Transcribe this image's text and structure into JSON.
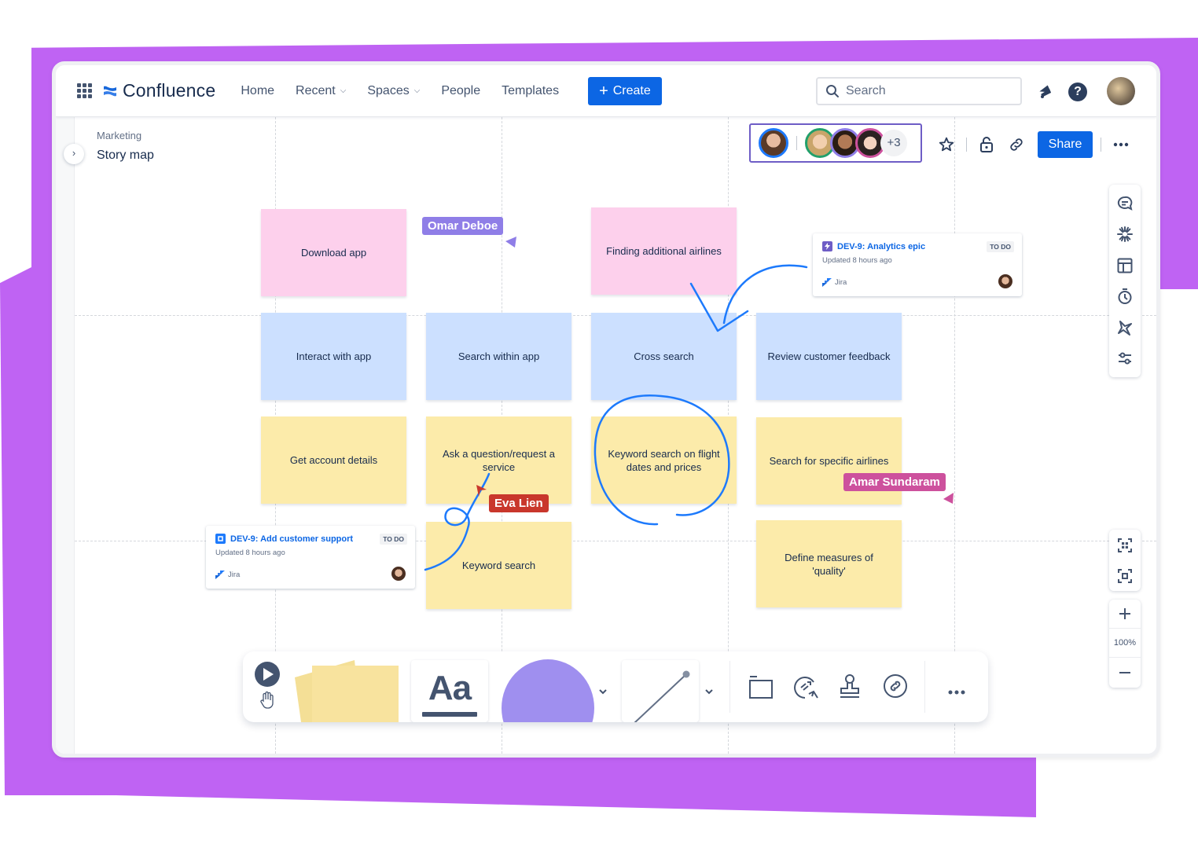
{
  "app": {
    "name": "Confluence"
  },
  "topnav": {
    "items": [
      {
        "label": "Home",
        "has_dropdown": false
      },
      {
        "label": "Recent",
        "has_dropdown": true
      },
      {
        "label": "Spaces",
        "has_dropdown": true
      },
      {
        "label": "People",
        "has_dropdown": false
      },
      {
        "label": "Templates",
        "has_dropdown": false
      }
    ],
    "create_label": "Create",
    "search_placeholder": "Search",
    "icons": [
      "app-switcher-icon",
      "notifications-icon",
      "help-icon",
      "profile-avatar"
    ]
  },
  "page": {
    "breadcrumb": "Marketing",
    "title": "Story map",
    "collaborators": {
      "current": {
        "ring_color": "#1d7afc"
      },
      "others": [
        {
          "ring_color": "#22a06b"
        },
        {
          "ring_color": "#8f7ee7"
        },
        {
          "ring_color": "#cd519d"
        }
      ],
      "more_count": "+3"
    },
    "actions": {
      "share_label": "Share"
    }
  },
  "right_toolbar": {
    "tools": [
      "comment-icon",
      "ai-sparkle-icon",
      "template-icon",
      "timer-icon",
      "vote-icon",
      "settings-sliders-icon"
    ],
    "zoom_level": "100%"
  },
  "stickies": [
    {
      "text": "Download app",
      "color": "pink"
    },
    {
      "text": "Finding additional airlines",
      "color": "pink"
    },
    {
      "text": "Interact with app",
      "color": "blue"
    },
    {
      "text": "Search within app",
      "color": "blue"
    },
    {
      "text": "Cross search",
      "color": "blue"
    },
    {
      "text": "Review customer feedback",
      "color": "blue"
    },
    {
      "text": "Get account details",
      "color": "yellow"
    },
    {
      "text": "Ask a question/request a service",
      "color": "yellow"
    },
    {
      "text": "Keyword search on flight dates and prices",
      "color": "yellow"
    },
    {
      "text": "Search for specific airlines",
      "color": "yellow"
    },
    {
      "text": "Keyword search",
      "color": "yellow"
    },
    {
      "text": "Define measures of 'quality'",
      "color": "yellow"
    }
  ],
  "jira_cards": [
    {
      "title": "DEV-9: Analytics epic",
      "status": "TO DO",
      "updated": "Updated 8 hours ago",
      "source": "Jira",
      "type": "epic",
      "type_color": "#6e5dc6"
    },
    {
      "title": "DEV-9: Add customer support",
      "status": "TO DO",
      "updated": "Updated 8 hours ago",
      "source": "Jira",
      "type": "story",
      "type_color": "#1d7afc"
    }
  ],
  "cursors": [
    {
      "name": "Omar Deboe",
      "color": "#8f7ee7"
    },
    {
      "name": "Eva Lien",
      "color": "#c9372c"
    },
    {
      "name": "Amar Sundaram",
      "color": "#cd519d"
    }
  ],
  "bottom_toolbar": {
    "tools": [
      "select-pointer-icon",
      "hand-pan-icon",
      "sticky-note-tool",
      "text-tool",
      "shape-tool",
      "shape-dropdown",
      "line-tool",
      "line-dropdown",
      "frame-icon",
      "smart-connect-icon",
      "stamp-icon",
      "link-icon",
      "more-icon"
    ],
    "text_tool_label": "Aa"
  },
  "colors": {
    "brand_blue": "#0c66e4",
    "backdrop_purple": "#bf63f3",
    "ink_blue": "#1d7afc"
  }
}
